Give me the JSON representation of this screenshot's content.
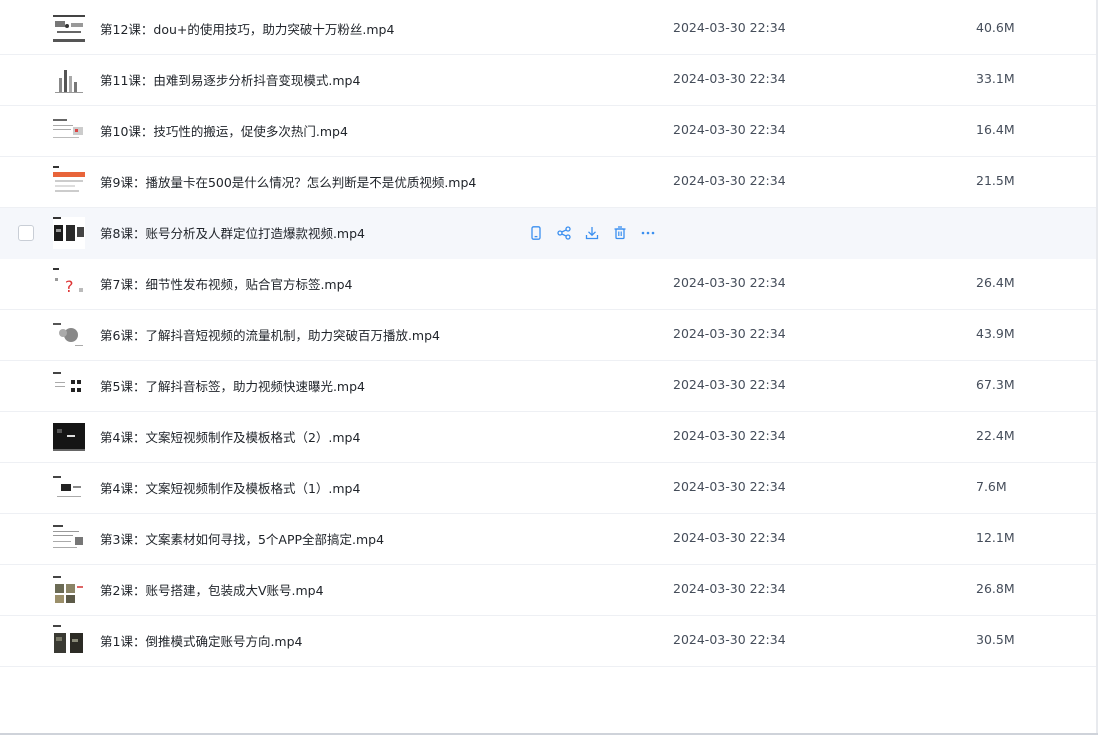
{
  "files": [
    {
      "name": "第12课：dou+的使用技巧，助力突破十万粉丝.mp4",
      "date": "2024-03-30 22:34",
      "size": "40.6M",
      "thumb": "thumb-12"
    },
    {
      "name": "第11课：由难到易逐步分析抖音变现模式.mp4",
      "date": "2024-03-30 22:34",
      "size": "33.1M",
      "thumb": "thumb-11"
    },
    {
      "name": "第10课：技巧性的搬运，促使多次热门.mp4",
      "date": "2024-03-30 22:34",
      "size": "16.4M",
      "thumb": "thumb-10"
    },
    {
      "name": "第9课：播放量卡在500是什么情况？怎么判断是不是优质视频.mp4",
      "date": "2024-03-30 22:34",
      "size": "21.5M",
      "thumb": "thumb-9"
    },
    {
      "name": "第8课：账号分析及人群定位打造爆款视频.mp4",
      "date": "",
      "size": "",
      "thumb": "thumb-8",
      "hovered": true
    },
    {
      "name": "第7课：细节性发布视频，贴合官方标签.mp4",
      "date": "2024-03-30 22:34",
      "size": "26.4M",
      "thumb": "thumb-7"
    },
    {
      "name": "第6课：了解抖音短视频的流量机制，助力突破百万播放.mp4",
      "date": "2024-03-30 22:34",
      "size": "43.9M",
      "thumb": "thumb-6"
    },
    {
      "name": "第5课：了解抖音标签，助力视频快速曝光.mp4",
      "date": "2024-03-30 22:34",
      "size": "67.3M",
      "thumb": "thumb-5"
    },
    {
      "name": "第4课：文案短视频制作及模板格式（2）.mp4",
      "date": "2024-03-30 22:34",
      "size": "22.4M",
      "thumb": "thumb-4b"
    },
    {
      "name": "第4课：文案短视频制作及模板格式（1）.mp4",
      "date": "2024-03-30 22:34",
      "size": "7.6M",
      "thumb": "thumb-4a"
    },
    {
      "name": "第3课：文案素材如何寻找，5个APP全部搞定.mp4",
      "date": "2024-03-30 22:34",
      "size": "12.1M",
      "thumb": "thumb-3"
    },
    {
      "name": "第2课：账号搭建，包装成大V账号.mp4",
      "date": "2024-03-30 22:34",
      "size": "26.8M",
      "thumb": "thumb-2"
    },
    {
      "name": "第1课：倒推模式确定账号方向.mp4",
      "date": "2024-03-30 22:34",
      "size": "30.5M",
      "thumb": "thumb-1"
    }
  ],
  "row_actions": [
    {
      "icon": "phone-icon",
      "name": "open-on-phone-button"
    },
    {
      "icon": "share-icon",
      "name": "share-button"
    },
    {
      "icon": "download-icon",
      "name": "download-button"
    },
    {
      "icon": "trash-icon",
      "name": "delete-button"
    },
    {
      "icon": "more-icon",
      "name": "more-button"
    }
  ],
  "colors": {
    "accent": "#3a8ff0",
    "hover_bg": "#f5f7fb",
    "text": "#1f2329",
    "meta": "#454d5a"
  }
}
